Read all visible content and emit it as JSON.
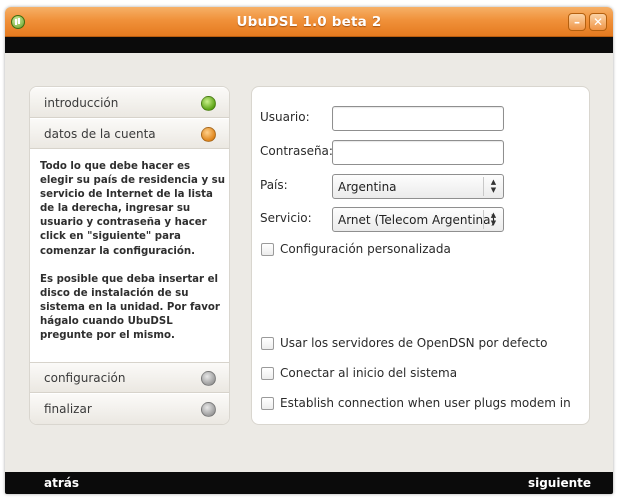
{
  "window": {
    "title": "UbuDSL 1.0 beta 2",
    "minimize_symbol": "–",
    "close_symbol": "✕"
  },
  "sidebar": {
    "items": [
      {
        "label": "introducción",
        "status": "green"
      },
      {
        "label": "datos de la cuenta",
        "status": "orange"
      },
      {
        "label": "configuración",
        "status": "gray"
      },
      {
        "label": "finalizar",
        "status": "gray"
      }
    ],
    "description": [
      "Todo lo que debe hacer es elegir su país de residencia y su servicio de Internet de la lista de la derecha, ingresar su usuario y contraseña y hacer click en \"siguiente\" para comenzar la configuración.",
      "Es posible que deba insertar el disco de instalación de su sistema en la unidad. Por favor hágalo cuando UbuDSL pregunte por el mismo."
    ]
  },
  "form": {
    "usuario_label": "Usuario:",
    "usuario_value": "",
    "password_label": "Contraseña:",
    "password_value": "",
    "pais_label": "País:",
    "pais_value": "Argentina",
    "servicio_label": "Servicio:",
    "servicio_value": "Arnet (Telecom Argentina)",
    "custom_config_label": "Configuración personalizada",
    "opendns_label": "Usar los servidores de OpenDSN por defecto",
    "startup_label": "Conectar al inicio del sistema",
    "plug_label": "Establish connection when user plugs modem in"
  },
  "footer": {
    "back_label": "atrás",
    "next_label": "siguiente"
  },
  "colors": {
    "titlebar": "#f0913a",
    "bars": "#0b0b0b",
    "background": "#eceae5"
  }
}
